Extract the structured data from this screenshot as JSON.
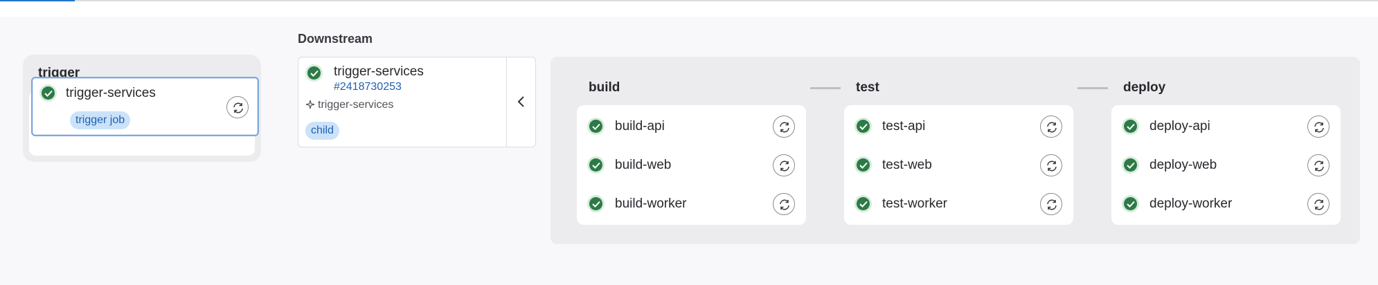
{
  "trigger_stage": {
    "title": "trigger",
    "job": {
      "name": "trigger-services",
      "badge": "trigger job",
      "status": "success"
    }
  },
  "downstream": {
    "title": "Downstream",
    "pipeline": {
      "name": "trigger-services",
      "id": "#2418730253",
      "source_job": "trigger-services",
      "badge": "child",
      "status": "success"
    }
  },
  "child_pipeline": {
    "stages": [
      {
        "title": "build",
        "jobs": [
          {
            "name": "build-api"
          },
          {
            "name": "build-web"
          },
          {
            "name": "build-worker"
          }
        ]
      },
      {
        "title": "test",
        "jobs": [
          {
            "name": "test-api"
          },
          {
            "name": "test-web"
          },
          {
            "name": "test-worker"
          }
        ]
      },
      {
        "title": "deploy",
        "jobs": [
          {
            "name": "deploy-api"
          },
          {
            "name": "deploy-web"
          },
          {
            "name": "deploy-worker"
          }
        ]
      }
    ]
  },
  "colors": {
    "success": "#2d7a47",
    "badge_bg": "#cbe2f9",
    "link": "#1f60b0",
    "selected_border": "#7fa8dc"
  },
  "icons": {
    "status": "check-circle-icon",
    "retry": "retry-icon",
    "collapse": "chevron-left-icon",
    "source": "sparkle-icon"
  }
}
